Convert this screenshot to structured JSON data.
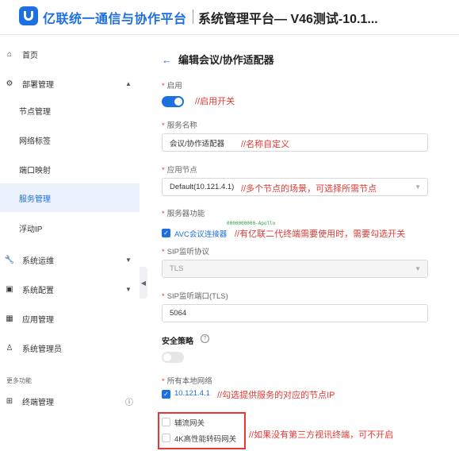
{
  "header": {
    "brand": "亿联统一通信与协作平台",
    "system_title": "系统管理平台— V46测试-10.1..."
  },
  "sidebar": {
    "home": "首页",
    "deploy_mgmt": "部署管理",
    "deploy_items": [
      "节点管理",
      "网络标签",
      "端口映射",
      "服务管理",
      "浮动IP"
    ],
    "sys_ops": "系统运维",
    "sys_config": "系统配置",
    "app_mgmt": "应用管理",
    "sys_admin": "系统管理员",
    "more_label": "更多功能",
    "terminal_mgmt": "终端管理"
  },
  "page": {
    "title": "编辑会议/协作适配器"
  },
  "form": {
    "enable_label": "启用",
    "enable_anno": "//启用开关",
    "service_name_label": "服务名称",
    "service_name_value": "会议/协作适配器",
    "service_name_anno": "//名称自定义",
    "node_label": "应用节点",
    "node_value": "Default(10.121.4.1)",
    "node_anno": "//多个节点的场景，可选择所需节点",
    "feature_label": "服务器功能",
    "apollo_tag": "0000000000-Apollo",
    "avc_label": "AVC会议连接器",
    "avc_anno": "//有亿联二代终端需要使用时，需要勾选开关",
    "sip_protocol_label": "SIP监听协议",
    "sip_protocol_value": "TLS",
    "sip_port_label": "SIP监听端口(TLS)",
    "sip_port_value": "5064",
    "security_label": "安全策略",
    "local_net_label": "所有本地网络",
    "local_net_value": "10.121.4.1",
    "local_net_anno": "//勾选提供服务的对应的节点IP",
    "aux_gateway_label": "辅流网关",
    "hd_transcode_label": "4K高性能转码网关",
    "gateway_anno": "//如果没有第三方视讯终端，可不开启"
  },
  "colors": {
    "primary": "#1e6fe0",
    "annotation": "#e53935"
  }
}
